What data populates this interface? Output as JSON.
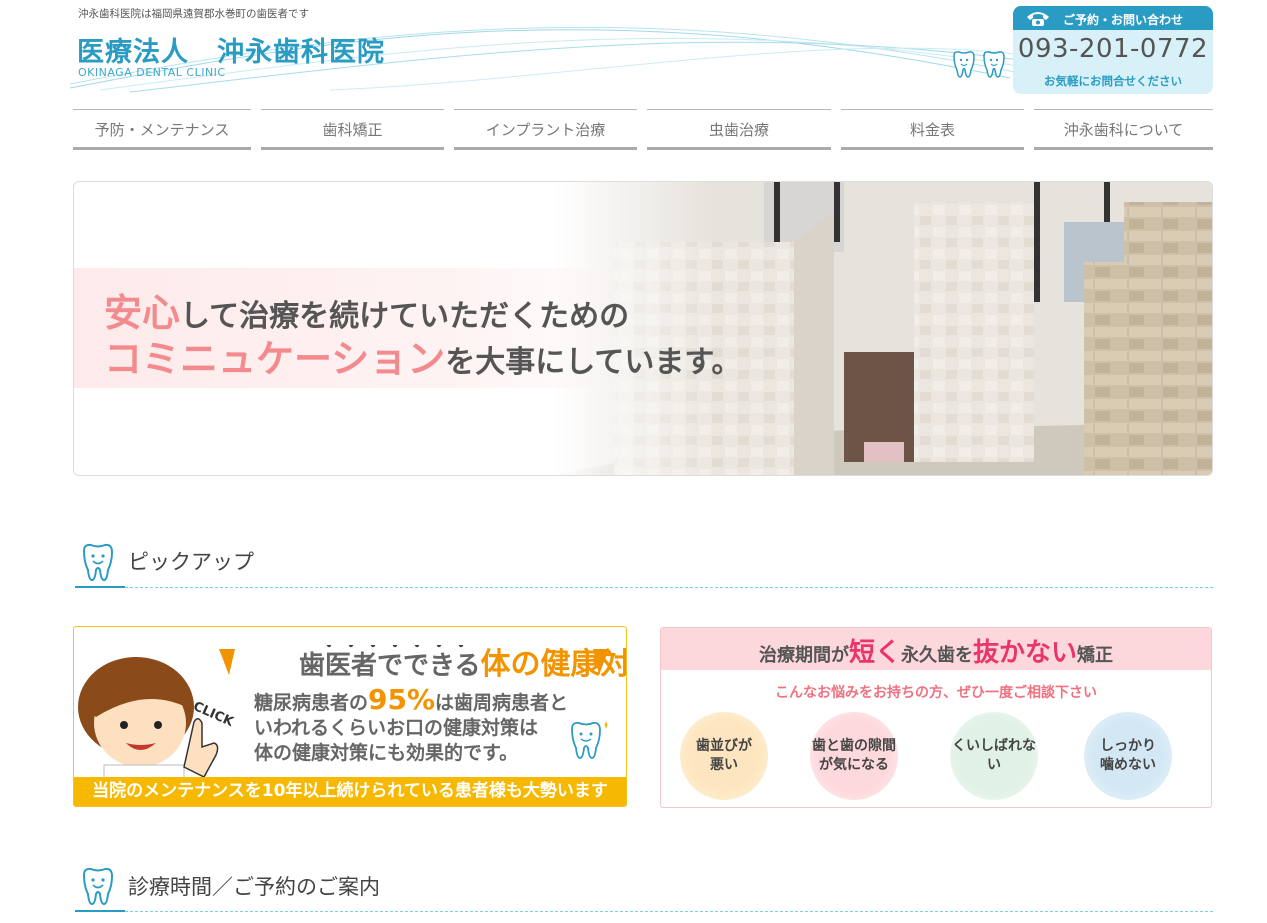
{
  "header": {
    "tagline": "沖永歯科医院は福岡県遠賀郡水巻町の歯医者です",
    "title": "医療法人　沖永歯科医院",
    "subtitle": "OKINAGA DENTAL CLINIC",
    "contact": {
      "label": "ご予約・お問い合わせ",
      "phone": "093-201-0772",
      "note": "お気軽にお問合せください"
    }
  },
  "nav": [
    {
      "label": "予防・メンテナンス"
    },
    {
      "label": "歯科矯正"
    },
    {
      "label": "インプラント治療"
    },
    {
      "label": "虫歯治療"
    },
    {
      "label": "料金表"
    },
    {
      "label": "沖永歯科について"
    }
  ],
  "hero": {
    "line1_highlight": "安心",
    "line1_rest": "して治療を続けていただくための",
    "line2_highlight": "コミニュケーション",
    "line2_rest": "を大事にしています。"
  },
  "sections": {
    "pickup": "ピックアップ",
    "hours": "診療時間／ご予約のご案内"
  },
  "banner_left": {
    "head_prefix": "歯医者でできる",
    "head_highlight": "体の健康対策！",
    "body_1": "糖尿病患者の",
    "body_pct": "95%",
    "body_2": "は歯周病患者と",
    "body_3": "いわれるくらいお口の健康対策は",
    "body_4": "体の健康対策にも効果的です。",
    "click": "CLICK",
    "footer": "当院のメンテナンスを10年以上続けられている患者様も大勢います"
  },
  "banner_right": {
    "head_1": "治療期間が",
    "head_hl1": "短く",
    "head_2": "永久歯を",
    "head_hl2": "抜かない",
    "head_3": "矯正",
    "sub": "こんなお悩みをお持ちの方、ぜひ一度ご相談下さい",
    "bubbles": [
      {
        "line1": "歯並びが",
        "line2": "悪い",
        "color": "#fdeccc"
      },
      {
        "line1": "歯と歯の隙間",
        "line2": "が気になる",
        "color": "#fde1e3"
      },
      {
        "line1": "くいしばれない",
        "line2": "",
        "color": "#e7f4ec"
      },
      {
        "line1": "しっかり",
        "line2": "噛めない",
        "color": "#dcedf6"
      }
    ]
  },
  "colors": {
    "brand_blue": "#2a9cc3",
    "pink": "#f28a8e",
    "orange": "#f19400",
    "yellow": "#f6b800"
  }
}
